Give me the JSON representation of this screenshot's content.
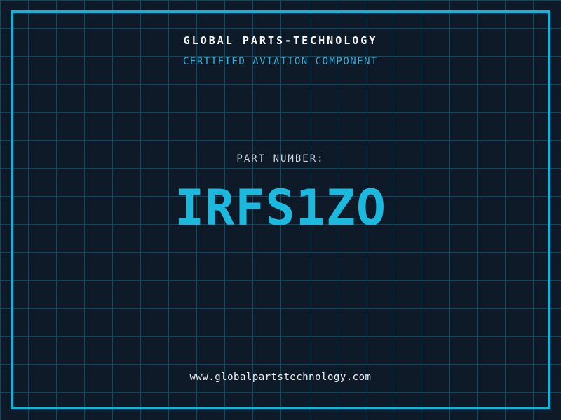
{
  "header": {
    "title": "GLOBAL PARTS-TECHNOLOGY",
    "subtitle": "CERTIFIED AVIATION COMPONENT"
  },
  "part": {
    "label": "PART NUMBER:",
    "number": "IRFS1ZO"
  },
  "footer": {
    "url": "www.globalpartstechnology.com"
  },
  "colors": {
    "background": "#0f1a28",
    "grid_line": "#17465b",
    "border": "#12b4dc",
    "title_text": "#f5f7f9",
    "subtitle_text": "#35b0d4",
    "label_text": "#c9d2da",
    "part_number_text": "#1cb9df",
    "url_text": "#eef2f5"
  }
}
